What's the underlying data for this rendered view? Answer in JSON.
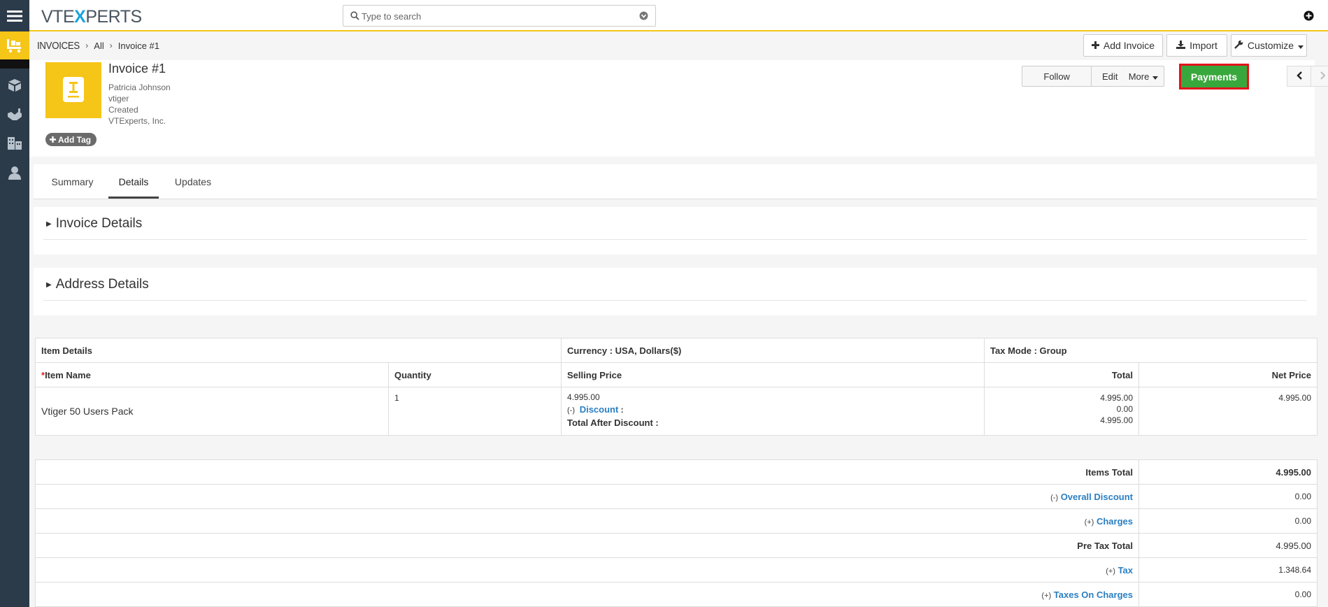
{
  "brand": {
    "logo_pre": "VTE",
    "logo_x": "X",
    "logo_post": "PERTS"
  },
  "search": {
    "placeholder": "Type to search"
  },
  "breadcrumb": {
    "module": "INVOICES",
    "filter": "All",
    "record": "Invoice #1"
  },
  "top_actions": {
    "add_invoice": "Add Invoice",
    "import": "Import",
    "customize": "Customize"
  },
  "record": {
    "title": "Invoice #1",
    "meta": [
      "Patricia Johnson",
      "vtiger",
      "Created",
      "VTExperts, Inc."
    ],
    "add_tag": "Add Tag",
    "actions": {
      "follow": "Follow",
      "edit": "Edit",
      "more": "More",
      "payments": "Payments"
    }
  },
  "tabs": [
    "Summary",
    "Details",
    "Updates"
  ],
  "active_tab": "Details",
  "blocks": [
    "Invoice Details",
    "Address Details"
  ],
  "item_table": {
    "header": {
      "item_details": "Item Details",
      "currency": "Currency : USA, Dollars($)",
      "tax_mode": "Tax Mode : Group"
    },
    "columns": {
      "item_name": "Item Name",
      "quantity": "Quantity",
      "selling_price": "Selling Price",
      "total": "Total",
      "net_price": "Net Price"
    },
    "rows": [
      {
        "name": "Vtiger 50 Users Pack",
        "quantity": "1",
        "price": "4.995.00",
        "discount_sign": "(-)",
        "discount_label": "Discount",
        "after_discount_label": "Total After Discount :",
        "total": "4.995.00",
        "discount_value": "0.00",
        "after_discount": "4.995.00",
        "net_price": "4.995.00"
      }
    ]
  },
  "totals": [
    {
      "sign": "",
      "label": "Items Total",
      "value": "4.995.00",
      "link": false,
      "bold": true
    },
    {
      "sign": "(-)",
      "label": "Overall Discount",
      "value": "0.00",
      "link": true,
      "bold": false
    },
    {
      "sign": "(+)",
      "label": "Charges",
      "value": "0.00",
      "link": true,
      "bold": false
    },
    {
      "sign": "",
      "label": "Pre Tax Total",
      "value": "4.995.00",
      "link": false,
      "bold": true
    },
    {
      "sign": "(+)",
      "label": "Tax",
      "value": "1.348.64",
      "link": true,
      "bold": false
    },
    {
      "sign": "(+)",
      "label": "Taxes On Charges",
      "value": "0.00",
      "link": true,
      "bold": false
    }
  ],
  "colors": {
    "accent": "#f5c518",
    "rail": "#2c3b49",
    "payments": "#39a83c",
    "highlight": "#e3141b",
    "link": "#2a7fc2"
  },
  "icons": [
    "menu-icon",
    "invoice-module-icon",
    "box-icon",
    "handshake-icon",
    "building-icon",
    "user-icon",
    "search-icon",
    "chevron-down-icon",
    "plus-circle-icon",
    "profile-icon",
    "plus-icon",
    "download-icon",
    "wrench-icon",
    "invoice-doc-icon",
    "chevron-left-icon",
    "chevron-right-icon"
  ]
}
